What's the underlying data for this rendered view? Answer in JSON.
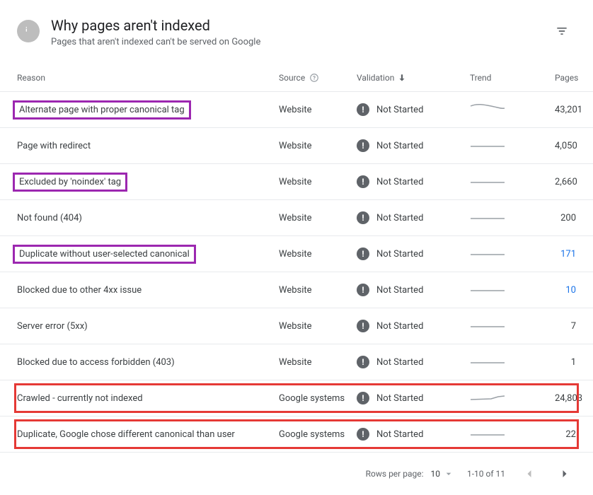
{
  "header": {
    "title": "Why pages aren't indexed",
    "subtitle": "Pages that aren't indexed can't be served on Google"
  },
  "columns": {
    "reason": "Reason",
    "source": "Source",
    "validation": "Validation",
    "trend": "Trend",
    "pages": "Pages"
  },
  "rows": [
    {
      "reason": "Alternate page with proper canonical tag",
      "source": "Website",
      "validation": "Not Started",
      "pages": "43,201",
      "highlight": "purple",
      "link": false,
      "trend": "curve"
    },
    {
      "reason": "Page with redirect",
      "source": "Website",
      "validation": "Not Started",
      "pages": "4,050",
      "highlight": "",
      "link": false,
      "trend": "flat"
    },
    {
      "reason": "Excluded by 'noindex' tag",
      "source": "Website",
      "validation": "Not Started",
      "pages": "2,660",
      "highlight": "purple",
      "link": false,
      "trend": "flat"
    },
    {
      "reason": "Not found (404)",
      "source": "Website",
      "validation": "Not Started",
      "pages": "200",
      "highlight": "",
      "link": false,
      "trend": "flat"
    },
    {
      "reason": "Duplicate without user-selected canonical",
      "source": "Website",
      "validation": "Not Started",
      "pages": "171",
      "highlight": "purple",
      "link": true,
      "trend": "flat"
    },
    {
      "reason": "Blocked due to other 4xx issue",
      "source": "Website",
      "validation": "Not Started",
      "pages": "10",
      "highlight": "",
      "link": true,
      "trend": "flat"
    },
    {
      "reason": "Server error (5xx)",
      "source": "Website",
      "validation": "Not Started",
      "pages": "7",
      "highlight": "",
      "link": false,
      "trend": "flat"
    },
    {
      "reason": "Blocked due to access forbidden (403)",
      "source": "Website",
      "validation": "Not Started",
      "pages": "1",
      "highlight": "",
      "link": false,
      "trend": "flat"
    },
    {
      "reason": "Crawled - currently not indexed",
      "source": "Google systems",
      "validation": "Not Started",
      "pages": "24,803",
      "highlight": "red",
      "link": false,
      "trend": "rise"
    },
    {
      "reason": "Duplicate, Google chose different canonical than user",
      "source": "Google systems",
      "validation": "Not Started",
      "pages": "22",
      "highlight": "red",
      "link": false,
      "trend": "flat"
    }
  ],
  "pager": {
    "rpp_label": "Rows per page:",
    "rpp_value": "10",
    "range": "1-10 of 11"
  }
}
